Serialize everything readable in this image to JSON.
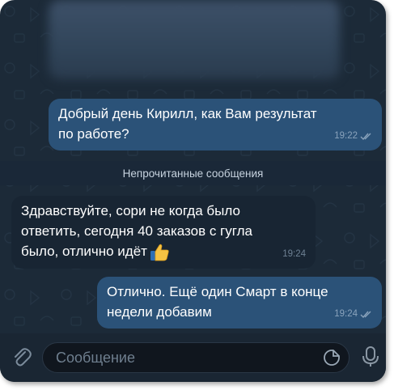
{
  "messages": [
    {
      "text": "Добрый день Кирилл, как Вам результат\nпо работе?",
      "time": "19:22",
      "direction": "outgoing",
      "read": true
    },
    {
      "text": "Здравствуйте, сори не когда было\nответить, сегодня 40 заказов с гугла\nбыло, отлично идёт",
      "time": "19:24",
      "direction": "incoming",
      "emoji": "thumbs-up-icon"
    },
    {
      "text": "Отлично. Ещё один Смарт в конце\nнедели добавим",
      "time": "19:24",
      "direction": "outgoing",
      "read": true
    }
  ],
  "unread_divider": "Непрочитанные сообщения",
  "composer": {
    "placeholder": "Сообщение"
  },
  "colors": {
    "background": "#1c2a38",
    "outgoing_bubble": "#2b5278",
    "incoming_bubble": "#182533",
    "accent": "#8aa3bc"
  }
}
